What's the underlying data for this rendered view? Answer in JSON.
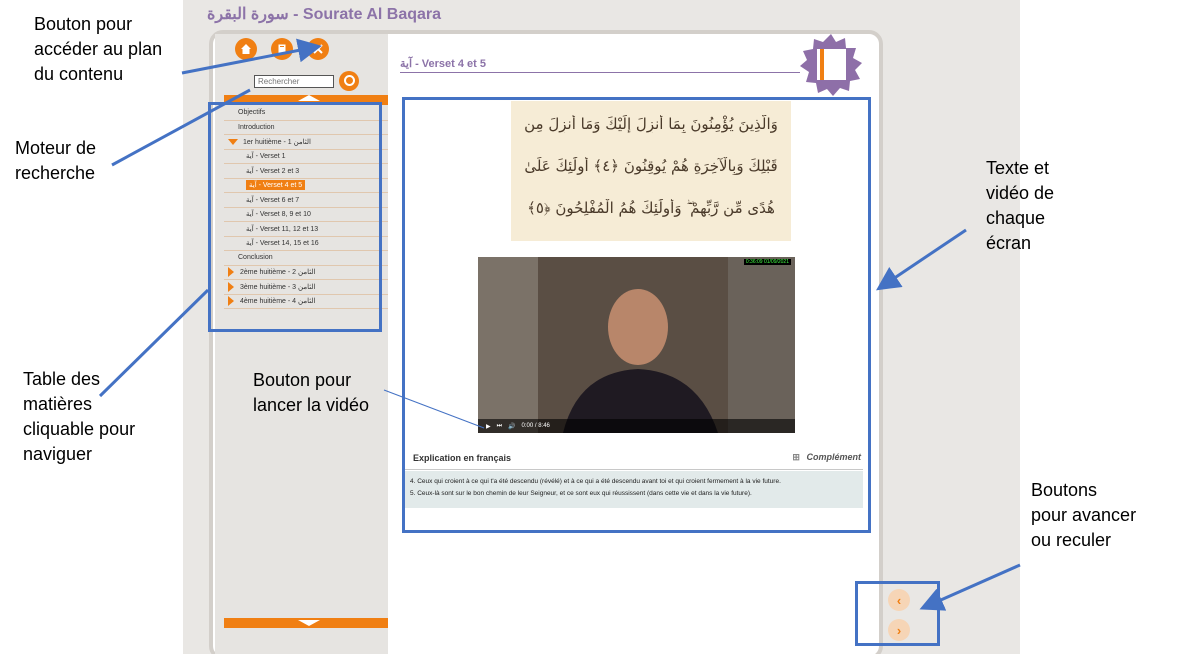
{
  "title": "سورة البقرة - Sourate Al Baqara",
  "search": {
    "placeholder": "Rechercher"
  },
  "toc": {
    "items": [
      {
        "label": "Objectifs",
        "marker": "none"
      },
      {
        "label": "Introduction",
        "marker": "none"
      },
      {
        "label": "1er huitième - الثامن 1",
        "marker": "down"
      },
      {
        "label": "آية - Verset 1",
        "marker": "sub"
      },
      {
        "label": "آية - Verset 2 et 3",
        "marker": "sub"
      },
      {
        "label": "آية - Verset 4 et 5",
        "marker": "active"
      },
      {
        "label": "آية - Verset 6 et 7",
        "marker": "sub"
      },
      {
        "label": "آية - Verset 8, 9 et 10",
        "marker": "sub"
      },
      {
        "label": "آية - Verset 11, 12 et 13",
        "marker": "sub"
      },
      {
        "label": "آية - Verset 14, 15 et 16",
        "marker": "sub"
      },
      {
        "label": "Conclusion",
        "marker": "none"
      },
      {
        "label": "2ème huitième - الثامن 2",
        "marker": "right"
      },
      {
        "label": "3ème huitième - الثامن 3",
        "marker": "right"
      },
      {
        "label": "4ème huitième - الثامن 4",
        "marker": "right"
      }
    ]
  },
  "content": {
    "title": "آية - Verset 4 et 5",
    "quran_lines": [
      "وَالَّذِينَ يُؤْمِنُونَ بِمَا أُنزِلَ إِلَيْكَ وَمَا أُنزِلَ مِن",
      "قَبْلِكَ وَبِالْآخِرَةِ هُمْ يُوقِنُونَ ﴿٤﴾ أُولَٰئِكَ عَلَىٰ",
      "هُدًى مِّن رَّبِّهِمْ ۖ وَأُولَٰئِكَ هُمُ الْمُفْلِحُونَ ﴿٥﴾"
    ],
    "video_time": "0:00 / 8:46",
    "video_stamp": "0:36:09 01/09/2021",
    "explanation_title": "Explication en français",
    "complement_label": "Complément",
    "explanation_lines": [
      "4. Ceux qui croient à ce qui t'a été descendu (révélé) et à ce qui a été descendu avant toi et qui croient fermement à la vie future.",
      "5. Ceux-là sont sur le bon chemin de leur Seigneur, et ce sont eux qui réussissent (dans cette vie et dans la vie future)."
    ]
  },
  "nav": {
    "prev": "‹",
    "next": "›"
  },
  "annotations": {
    "plan": "Bouton pour\naccéder au plan\ndu contenu",
    "search": "Moteur de\nrecherche",
    "toc": "Table des\nmatières\ncliquable pour\nnaviguer",
    "video": "Bouton pour\nlancer la vidéo",
    "text": "Texte et\nvidéo de\nchaque\nécran",
    "nav": "Boutons\npour avancer\nou reculer"
  },
  "colors": {
    "accent": "#f07f13",
    "title": "#8c73a8",
    "annotation": "#4472c4"
  }
}
